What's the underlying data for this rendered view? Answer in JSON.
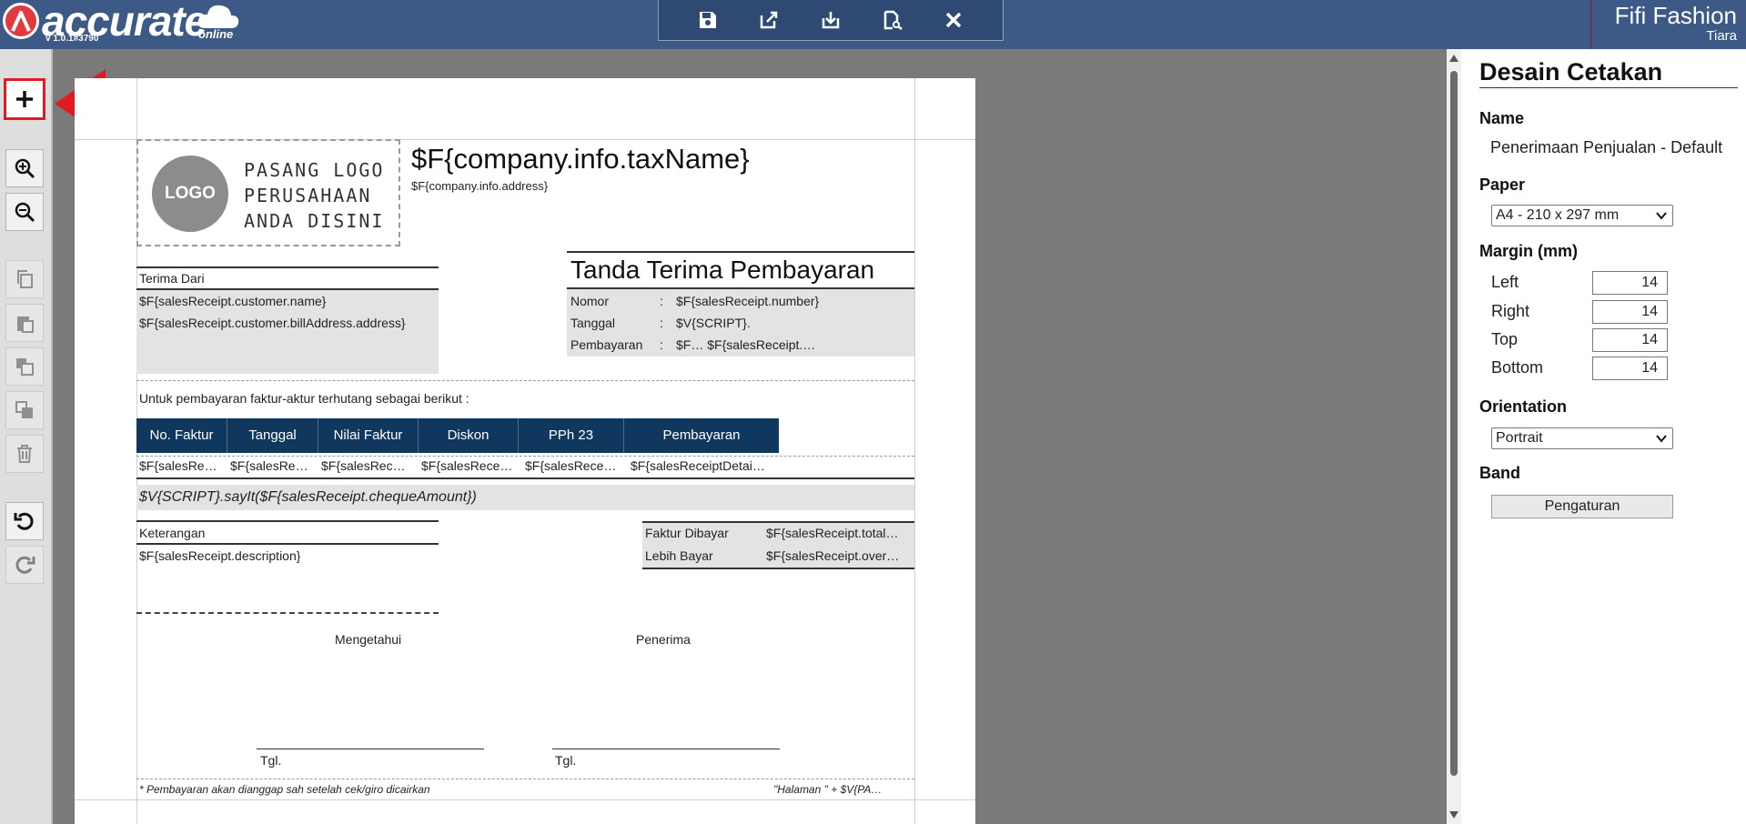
{
  "header": {
    "brand": "accurate",
    "brand_suffix": "online",
    "version": "v 1.0.1#3790",
    "company_name": "Fifi Fashion",
    "user_name": "Tiara",
    "accent": "#3d5a86",
    "toolbar_icons": [
      "save-icon",
      "export-icon",
      "import-icon",
      "preview-icon",
      "close-icon"
    ]
  },
  "sidebar_icons": [
    "add-icon",
    "zoom-in-icon",
    "zoom-out-icon",
    "copy-icon",
    "paste-icon",
    "bring-front-icon",
    "send-back-icon",
    "delete-icon",
    "undo-icon",
    "redo-icon"
  ],
  "document": {
    "logo_badge": "LOGO",
    "logo_lines": [
      "PASANG LOGO",
      "PERUSAHAAN",
      "ANDA DISINI"
    ],
    "tax_name": "$F{company.info.taxName}",
    "address": "$F{company.info.address}",
    "receive_from_label": "Terima Dari",
    "customer_name": "$F{salesReceipt.customer.name}",
    "customer_address": "$F{salesReceipt.customer.billAddress.address}",
    "doc_title": "Tanda Terima Pembayaran",
    "info_rows": [
      {
        "label": "Nomor",
        "value": "$F{salesReceipt.number}"
      },
      {
        "label": "Tanggal",
        "value": "$V{SCRIPT}."
      },
      {
        "label": "Pembayaran",
        "value": "$F…   $F{salesReceipt.…"
      }
    ],
    "colon": ":",
    "intro": "Untuk pembayaran faktur-aktur terhutang sebagai berikut :",
    "table_headers": [
      "No. Faktur",
      "Tanggal",
      "Nilai Faktur",
      "Diskon",
      "PPh 23",
      "Pembayaran"
    ],
    "table_row": [
      "$F{salesRe…",
      "$F{salesRe…",
      "$F{salesRec…",
      "$F{salesRece…",
      "$F{salesRece…",
      "$F{salesReceiptDetai…"
    ],
    "say_it": "$V{SCRIPT}.sayIt($F{salesReceipt.chequeAmount})",
    "notes_label": "Keterangan",
    "notes_value": "$F{salesReceipt.description}",
    "paid_label": "Faktur Dibayar",
    "paid_value": "$F{salesReceipt.total…",
    "over_label": "Lebih Bayar",
    "over_value": "$F{salesReceipt.over…",
    "sign_left": "Mengetahui",
    "sign_right": "Penerima",
    "date_label": "Tgl.",
    "footer_note": "* Pembayaran akan dianggap sah setelah cek/giro dicairkan",
    "footer_page": "\"Halaman \" +  $V{PA…"
  },
  "panel": {
    "title": "Desain Cetakan",
    "name_label": "Name",
    "name_value": "Penerimaan Penjualan - Default",
    "paper_label": "Paper",
    "paper_value": "A4 - 210 x 297 mm",
    "margin_label": "Margin (mm)",
    "margins": [
      {
        "label": "Left",
        "value": "14"
      },
      {
        "label": "Right",
        "value": "14"
      },
      {
        "label": "Top",
        "value": "14"
      },
      {
        "label": "Bottom",
        "value": "14"
      }
    ],
    "orientation_label": "Orientation",
    "orientation_value": "Portrait",
    "band_label": "Band",
    "band_button": "Pengaturan"
  }
}
